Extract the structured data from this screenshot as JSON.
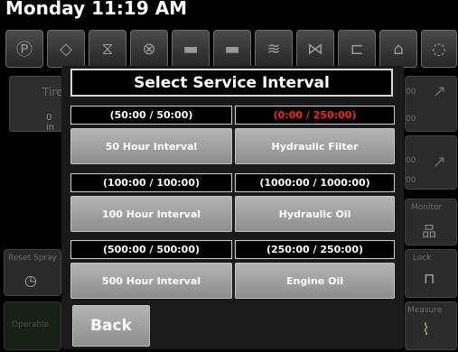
{
  "header": {
    "datetime": "Monday 11:19 AM"
  },
  "toolbar_icons": [
    "parking-brake-icon",
    "warning-icon",
    "hydraulic-fluid-icon",
    "engine-icon",
    "engine-block-icon",
    "engine-block-2-icon",
    "coolant-icon",
    "air-filter-icon",
    "fuel-icon",
    "oil-can-icon",
    "oil-drop-icon"
  ],
  "background": {
    "left_tile_label": "Tire",
    "left_tile_value": "0 in",
    "reset_spray_label": "Reset Spray",
    "operable_label": "Operable",
    "monitor_label": "Monitor",
    "lock_label": "Lock",
    "measure_label": "Measure",
    "gauge_top_a": "00",
    "gauge_bottom_a": "00",
    "gauge_top_b": "00",
    "gauge_bottom_b": "00"
  },
  "dialog": {
    "title": "Select Service Interval",
    "intervals": [
      {
        "value": "(50:00 / 50:00)",
        "label": "50 Hour Interval"
      },
      {
        "value": "(0:00 / 250:00)",
        "label": "Hydraulic Filter",
        "overdue": true,
        "color": "#ff2020"
      },
      {
        "value": "(100:00 / 100:00)",
        "label": "100 Hour Interval"
      },
      {
        "value": "(1000:00 / 1000:00)",
        "label": "Hydraulic Oil"
      },
      {
        "value": "(500:00 / 500:00)",
        "label": "500 Hour Interval"
      },
      {
        "value": "(250:00 / 250:00)",
        "label": "Engine Oil"
      }
    ],
    "back_label": "Back"
  }
}
